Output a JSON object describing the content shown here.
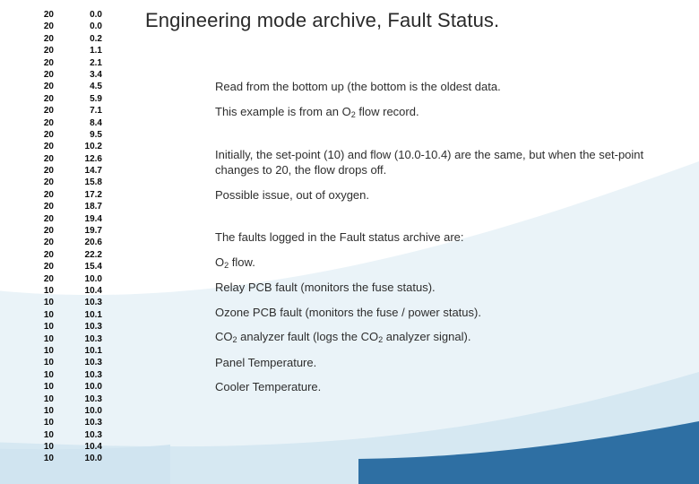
{
  "title": "Engineering mode archive, Fault Status.",
  "body": {
    "p1": "Read from the bottom up (the bottom is the oldest data.",
    "p2a": "This example is from an O",
    "p2b": " flow record.",
    "p3": "Initially, the set-point (10) and flow (10.0-10.4) are the same, but when the set-point changes to 20, the flow drops off.",
    "p4": "Possible issue, out of oxygen.",
    "p5": "The faults logged in the Fault status archive are:",
    "f1a": "O",
    "f1b": " flow.",
    "f2": "Relay PCB fault (monitors the fuse status).",
    "f3": "Ozone PCB fault (monitors the fuse / power status).",
    "f4a": "CO",
    "f4b": " analyzer fault (logs the CO",
    "f4c": " analyzer signal).",
    "f5": "Panel Temperature.",
    "f6": "Cooler Temperature.",
    "sub2": "2"
  },
  "data_rows": [
    {
      "a": "20",
      "b": "0.0"
    },
    {
      "a": "20",
      "b": "0.0"
    },
    {
      "a": "20",
      "b": "0.2"
    },
    {
      "a": "20",
      "b": "1.1"
    },
    {
      "a": "20",
      "b": "2.1"
    },
    {
      "a": "20",
      "b": "3.4"
    },
    {
      "a": "20",
      "b": "4.5"
    },
    {
      "a": "20",
      "b": "5.9"
    },
    {
      "a": "20",
      "b": "7.1"
    },
    {
      "a": "20",
      "b": "8.4"
    },
    {
      "a": "20",
      "b": "9.5"
    },
    {
      "a": "20",
      "b": "10.2"
    },
    {
      "a": "20",
      "b": "12.6"
    },
    {
      "a": "20",
      "b": "14.7"
    },
    {
      "a": "20",
      "b": "15.8"
    },
    {
      "a": "20",
      "b": "17.2"
    },
    {
      "a": "20",
      "b": "18.7"
    },
    {
      "a": "20",
      "b": "19.4"
    },
    {
      "a": "20",
      "b": "19.7"
    },
    {
      "a": "20",
      "b": "20.6"
    },
    {
      "a": "20",
      "b": "22.2"
    },
    {
      "a": "20",
      "b": "15.4"
    },
    {
      "a": "20",
      "b": "10.0"
    },
    {
      "a": "10",
      "b": "10.4"
    },
    {
      "a": "10",
      "b": "10.3"
    },
    {
      "a": "10",
      "b": "10.1"
    },
    {
      "a": "10",
      "b": "10.3"
    },
    {
      "a": "10",
      "b": "10.3"
    },
    {
      "a": "10",
      "b": "10.1"
    },
    {
      "a": "10",
      "b": "10.3"
    },
    {
      "a": "10",
      "b": "10.3"
    },
    {
      "a": "10",
      "b": "10.0"
    },
    {
      "a": "10",
      "b": "10.3"
    },
    {
      "a": "10",
      "b": "10.0"
    },
    {
      "a": "10",
      "b": "10.3"
    },
    {
      "a": "10",
      "b": "10.3"
    },
    {
      "a": "10",
      "b": "10.4"
    },
    {
      "a": "10",
      "b": "10.0"
    }
  ],
  "decor": {
    "swoosh_light": "#d8e9f3",
    "swoosh_dark": "#2e6fa3"
  }
}
